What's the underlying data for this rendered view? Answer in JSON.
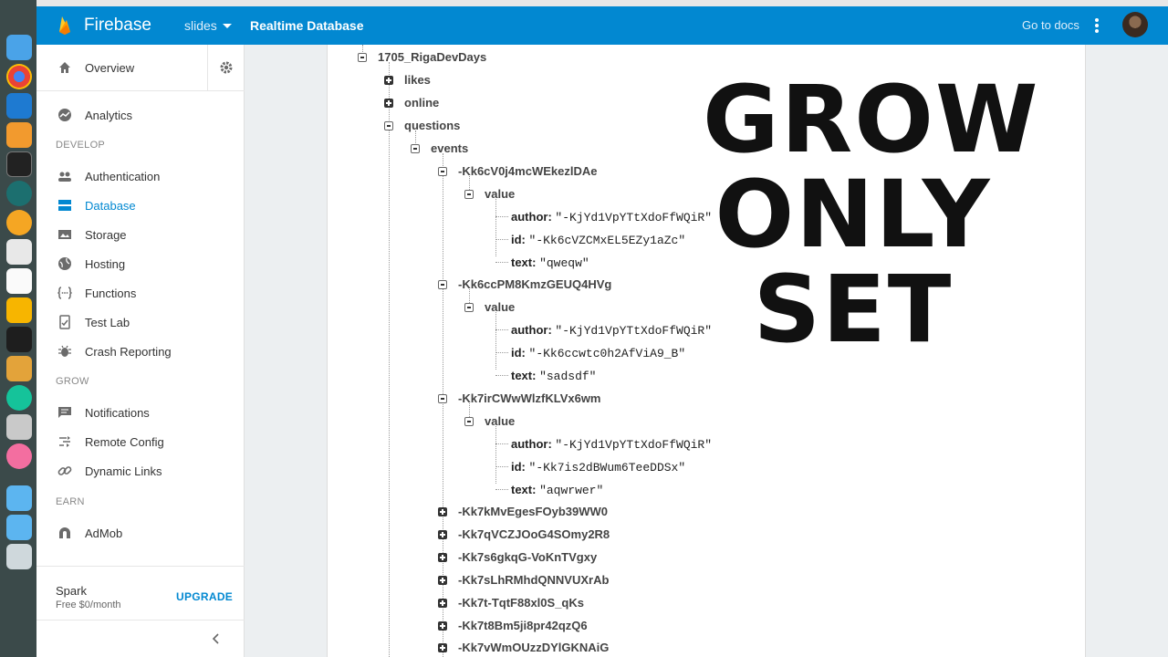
{
  "dock": {
    "apps": [
      "finder-icon",
      "chrome-icon",
      "vscode-icon",
      "sublime-icon",
      "terminal-icon",
      "gitkraken-icon",
      "transmit-icon",
      "slack-icon",
      "ia-writer-icon",
      "sketch-icon",
      "figma-icon",
      "keynote-icon",
      "grammarly-icon",
      "preview-icon",
      "itunes-icon",
      "apps-folder-icon",
      "downloads-folder-icon",
      "trash-icon"
    ]
  },
  "topbar": {
    "brand": "Firebase",
    "project": "slides",
    "page": "Realtime Database",
    "docs": "Go to docs",
    "color": "#0288d1"
  },
  "sidebar": {
    "overview": "Overview",
    "analytics": "Analytics",
    "develop": "DEVELOP",
    "develop_items": [
      {
        "label": "Authentication",
        "icon": "people-icon"
      },
      {
        "label": "Database",
        "icon": "database-icon"
      },
      {
        "label": "Storage",
        "icon": "image-icon"
      },
      {
        "label": "Hosting",
        "icon": "globe-icon"
      },
      {
        "label": "Functions",
        "icon": "functions-icon"
      },
      {
        "label": "Test Lab",
        "icon": "testlab-icon"
      },
      {
        "label": "Crash Reporting",
        "icon": "bug-icon"
      }
    ],
    "grow": "GROW",
    "grow_items": [
      {
        "label": "Notifications",
        "icon": "message-icon"
      },
      {
        "label": "Remote Config",
        "icon": "remote-config-icon"
      },
      {
        "label": "Dynamic Links",
        "icon": "link-icon"
      }
    ],
    "earn": "EARN",
    "earn_items": [
      {
        "label": "AdMob",
        "icon": "admob-icon"
      }
    ],
    "plan_name": "Spark",
    "plan_price": "Free $0/month",
    "upgrade": "UPGRADE"
  },
  "tree": {
    "root": "1705_RigaDevDays",
    "likes": "likes",
    "online": "online",
    "questions": "questions",
    "events": "events",
    "entries": [
      {
        "key": "-Kk6cV0j4mcWEkezlDAe",
        "value": "value",
        "author_k": "author:",
        "author_v": "\"-KjYd1VpYTtXdoFfWQiR\"",
        "id_k": "id:",
        "id_v": "\"-Kk6cVZCMxEL5EZy1aZc\"",
        "text_k": "text:",
        "text_v": "\"qweqw\""
      },
      {
        "key": "-Kk6ccPM8KmzGEUQ4HVg",
        "value": "value",
        "author_k": "author:",
        "author_v": "\"-KjYd1VpYTtXdoFfWQiR\"",
        "id_k": "id:",
        "id_v": "\"-Kk6ccwtc0h2AfViA9_B\"",
        "text_k": "text:",
        "text_v": "\"sadsdf\""
      },
      {
        "key": "-Kk7irCWwWlzfKLVx6wm",
        "value": "value",
        "author_k": "author:",
        "author_v": "\"-KjYd1VpYTtXdoFfWQiR\"",
        "id_k": "id:",
        "id_v": "\"-Kk7is2dBWum6TeeDDSx\"",
        "text_k": "text:",
        "text_v": "\"aqwrwer\""
      }
    ],
    "collapsed": [
      "-Kk7kMvEgesFOyb39WW0",
      "-Kk7qVCZJOoG4SOmy2R8",
      "-Kk7s6gkqG-VoKnTVgxy",
      "-Kk7sLhRMhdQNNVUXrAb",
      "-Kk7t-TqtF88xl0S_qKs",
      "-Kk7t8Bm5ji8pr42qzQ6",
      "-Kk7vWmOUzzDYlGKNAiG"
    ]
  },
  "overlay": {
    "line1": "GROW",
    "line2": "ONLY",
    "line3": "SET"
  }
}
